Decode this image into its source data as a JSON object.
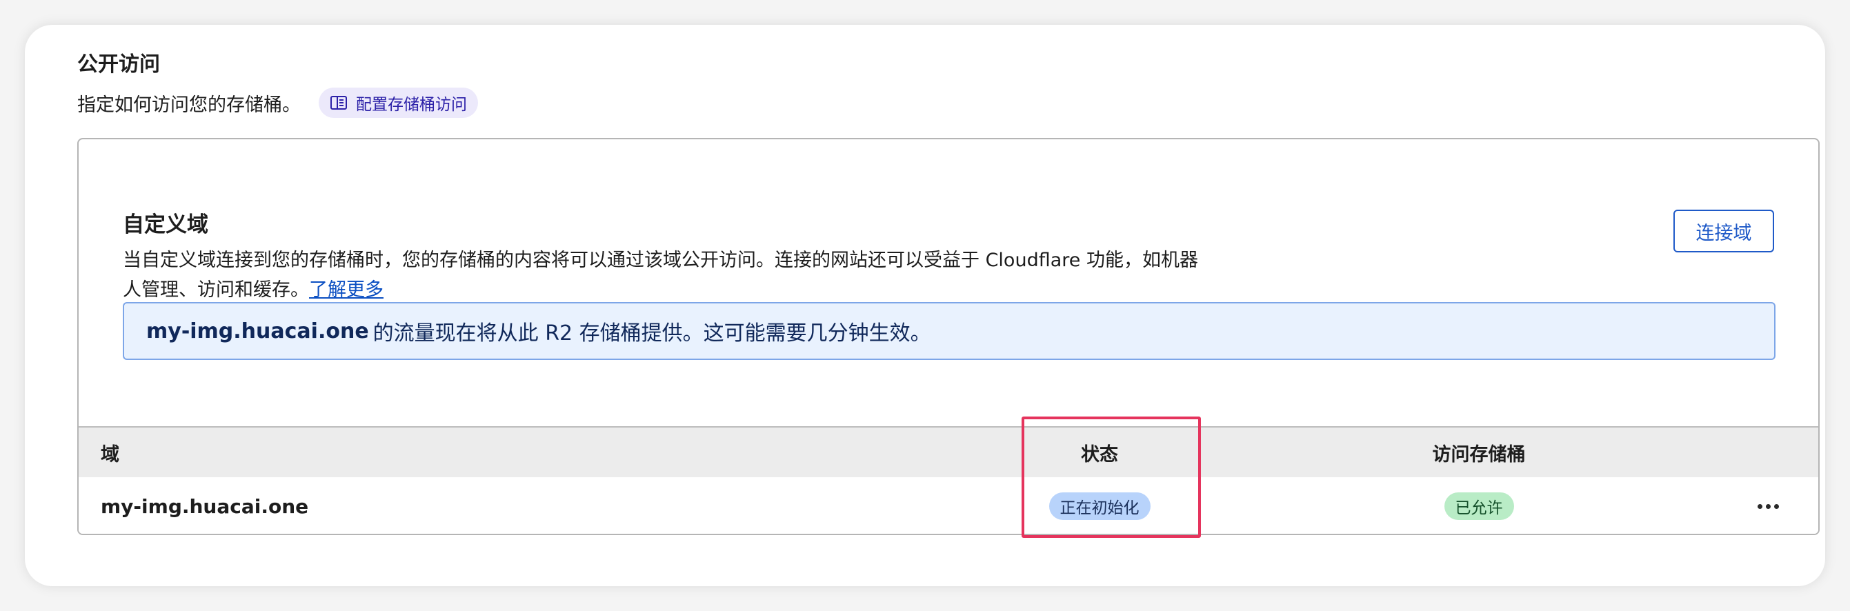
{
  "section": {
    "title": "公开访问",
    "description": "指定如何访问您的存储桶。",
    "docs_link": "配置存储桶访问",
    "docs_icon": "book-icon"
  },
  "custom_domain": {
    "title": "自定义域",
    "description": "当自定义域连接到您的存储桶时，您的存储桶的内容将可以通过该域公开访问。连接的网站还可以受益于 Cloudflare 功能，如机器人管理、访问和缓存。",
    "learn_more": "了解更多",
    "connect_button": "连接域",
    "notice": {
      "domain": "my-img.huacai.one",
      "text": "的流量现在将从此 R2 存储桶提供。这可能需要几分钟生效。"
    }
  },
  "table": {
    "columns": [
      "域",
      "状态",
      "访问存储桶"
    ],
    "rows": [
      {
        "domain": "my-img.huacai.one",
        "status": "正在初始化",
        "access": "已允许",
        "more_icon": "ellipsis-icon"
      }
    ]
  },
  "colors": {
    "accent": "#1f5ac8",
    "notice_bg": "#e9f2fe",
    "status_badge": "#b8d3fb",
    "access_badge": "#b9ecc6",
    "highlight": "#e5345d"
  }
}
